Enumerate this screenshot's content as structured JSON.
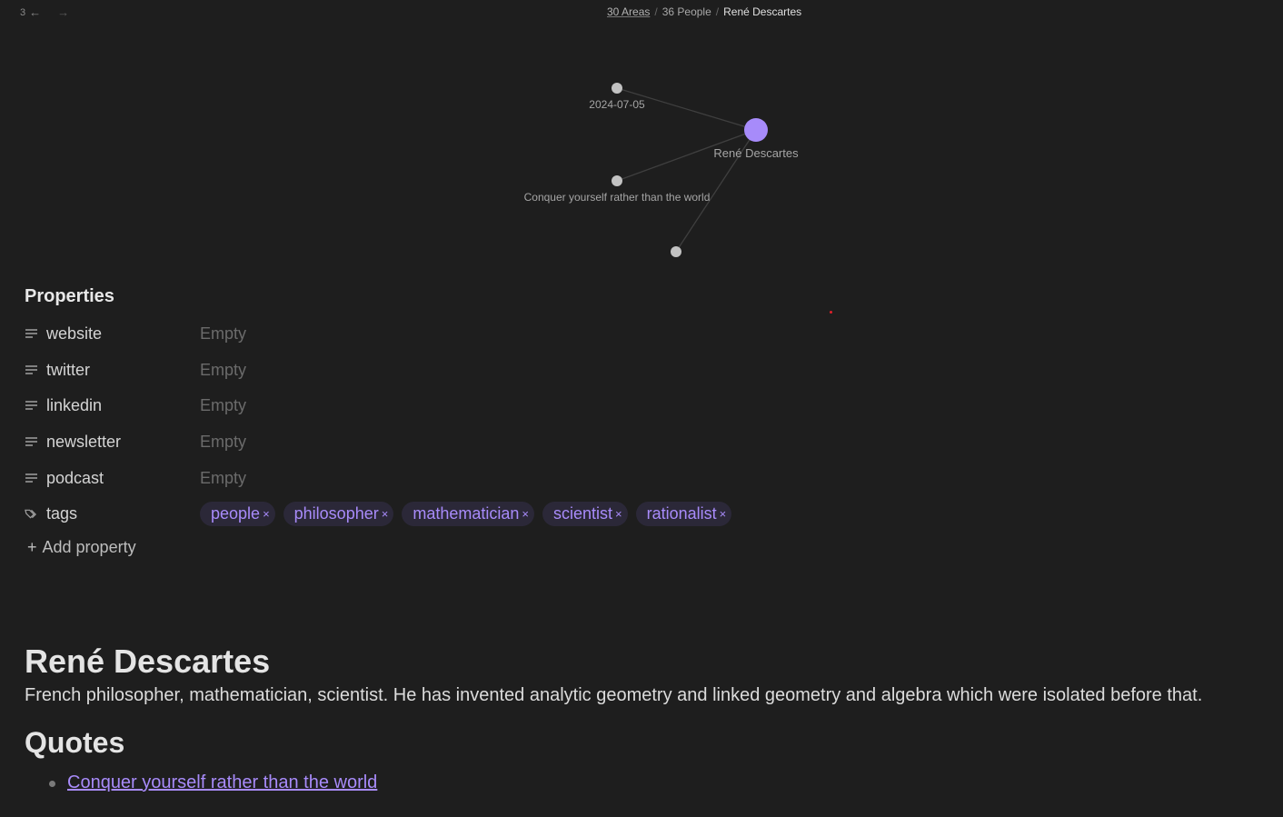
{
  "nav": {
    "history_count": "3",
    "back_icon": "arrow-left-icon",
    "forward_icon": "arrow-right-icon"
  },
  "breadcrumb": {
    "items": [
      "30 Areas",
      "36 People"
    ],
    "separator": "/",
    "current": "René Descartes"
  },
  "graph": {
    "nodes": [
      {
        "id": "center",
        "label": "René Descartes",
        "color": "#a78bfa",
        "active": true
      },
      {
        "id": "date",
        "label": "2024-07-05",
        "color": "#c2c2c2"
      },
      {
        "id": "quote",
        "label": "Conquer yourself rather than the world",
        "color": "#c2c2c2"
      },
      {
        "id": "unlabeled",
        "label": "",
        "color": "#c2c2c2"
      }
    ],
    "edges": [
      [
        "center",
        "date"
      ],
      [
        "center",
        "quote"
      ],
      [
        "center",
        "unlabeled"
      ]
    ]
  },
  "properties": {
    "title": "Properties",
    "rows": [
      {
        "key": "website",
        "icon": "text-lines-icon",
        "value": "Empty"
      },
      {
        "key": "twitter",
        "icon": "text-lines-icon",
        "value": "Empty"
      },
      {
        "key": "linkedin",
        "icon": "text-lines-icon",
        "value": "Empty"
      },
      {
        "key": "newsletter",
        "icon": "text-lines-icon",
        "value": "Empty"
      },
      {
        "key": "podcast",
        "icon": "text-lines-icon",
        "value": "Empty"
      }
    ],
    "tags_key": "tags",
    "tags": [
      "people",
      "philosopher",
      "mathematician",
      "scientist",
      "rationalist"
    ],
    "tag_remove": "×",
    "add_label": "Add property",
    "add_icon": "+"
  },
  "document": {
    "title": "René Descartes",
    "description": "French philosopher, mathematician, scientist. He has invented analytic geometry and linked geometry and algebra which were isolated before that.",
    "quotes_heading": "Quotes",
    "quotes": [
      "Conquer yourself rather than the world"
    ]
  },
  "colors": {
    "accent": "#a88bfa",
    "background": "#1e1e1e",
    "tag_bg": "#2b2838"
  }
}
